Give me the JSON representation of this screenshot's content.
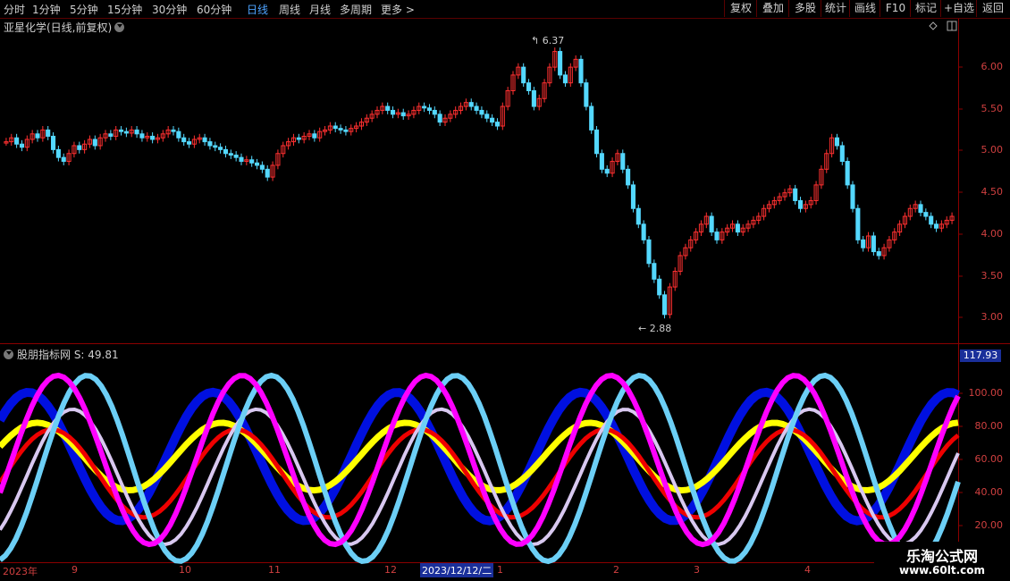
{
  "timeframes": [
    "分时",
    "1分钟",
    "5分钟",
    "15分钟",
    "30分钟",
    "60分钟",
    "日线",
    "周线",
    "月线",
    "多周期",
    "更多 >"
  ],
  "active_timeframe": "日线",
  "right_buttons": [
    "复权",
    "叠加",
    "多股",
    "统计",
    "画线",
    "F10",
    "标记",
    "+自选",
    "返回"
  ],
  "stock_title": "亚星化学(日线,前复权)",
  "price_axis": [
    "6.00",
    "5.50",
    "5.00",
    "4.50",
    "4.00",
    "3.50",
    "3.00"
  ],
  "price_high_label": "6.37",
  "price_low_label": "2.88",
  "indicator_title": "股朋指标网 S: 49.81",
  "ind_axis": [
    "100.00",
    "80.00",
    "60.00",
    "40.00",
    "20.00"
  ],
  "ind_badge": "117.93",
  "date_labels": [
    "2023年",
    "9",
    "10",
    "11",
    "12",
    "1",
    "2",
    "3",
    "4"
  ],
  "date_selected": "2023/12/12/二",
  "watermark_title": "乐淘公式网",
  "watermark_url": "www.60lt.com",
  "colors": {
    "up": "#ff3030",
    "down": "#54d8ff",
    "axis": "#d04040",
    "frame": "#8b0000",
    "magenta": "#ff00ff",
    "cyan": "#6ccff6",
    "lavender": "#d8c8f0",
    "red": "#ee0000",
    "yellow": "#ffff00",
    "blue": "#0010e0"
  },
  "chart_data": [
    {
      "type": "candlestick",
      "title": "亚星化学(日线,前复权)",
      "ylim": [
        2.8,
        6.5
      ],
      "high": 6.37,
      "low": 2.88,
      "closes": [
        5.15,
        5.2,
        5.12,
        5.08,
        5.18,
        5.25,
        5.2,
        5.3,
        5.22,
        5.05,
        4.95,
        4.9,
        5.0,
        5.1,
        5.05,
        5.12,
        5.18,
        5.1,
        5.2,
        5.25,
        5.22,
        5.3,
        5.28,
        5.26,
        5.3,
        5.25,
        5.2,
        5.22,
        5.18,
        5.2,
        5.25,
        5.3,
        5.28,
        5.2,
        5.15,
        5.12,
        5.18,
        5.2,
        5.15,
        5.1,
        5.08,
        5.05,
        5.0,
        4.98,
        4.95,
        4.9,
        4.92,
        4.88,
        4.85,
        4.8,
        4.7,
        4.85,
        5.0,
        5.1,
        5.15,
        5.2,
        5.18,
        5.22,
        5.25,
        5.2,
        5.28,
        5.3,
        5.35,
        5.32,
        5.3,
        5.28,
        5.32,
        5.35,
        5.4,
        5.45,
        5.5,
        5.55,
        5.6,
        5.55,
        5.5,
        5.52,
        5.48,
        5.5,
        5.55,
        5.6,
        5.58,
        5.55,
        5.5,
        5.4,
        5.45,
        5.5,
        5.55,
        5.6,
        5.65,
        5.6,
        5.55,
        5.5,
        5.45,
        5.4,
        5.35,
        5.6,
        5.8,
        6.0,
        6.1,
        5.9,
        5.8,
        5.6,
        5.7,
        5.9,
        6.1,
        6.3,
        6.0,
        5.9,
        6.1,
        6.2,
        5.9,
        5.6,
        5.3,
        5.0,
        4.8,
        4.75,
        4.9,
        5.0,
        4.8,
        4.6,
        4.3,
        4.1,
        3.9,
        3.6,
        3.4,
        3.2,
        2.95,
        3.3,
        3.5,
        3.7,
        3.8,
        3.9,
        4.0,
        4.1,
        4.2,
        4.0,
        3.9,
        4.0,
        4.05,
        4.1,
        4.0,
        4.05,
        4.1,
        4.15,
        4.2,
        4.3,
        4.35,
        4.4,
        4.45,
        4.5,
        4.55,
        4.4,
        4.3,
        4.35,
        4.4,
        4.6,
        4.8,
        5.0,
        5.2,
        5.1,
        4.9,
        4.6,
        4.3,
        3.9,
        3.8,
        3.95,
        3.75,
        3.7,
        3.8,
        3.9,
        4.0,
        4.1,
        4.2,
        4.3,
        4.35,
        4.25,
        4.2,
        4.1,
        4.05,
        4.1,
        4.15,
        4.2
      ]
    },
    {
      "type": "line",
      "title": "股朋指标网",
      "ylim": [
        0,
        117.93
      ],
      "series_count": 5,
      "last_value": 49.81
    }
  ]
}
